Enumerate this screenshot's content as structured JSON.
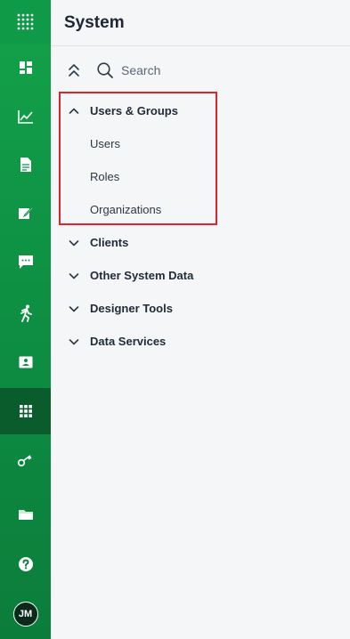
{
  "rail": {
    "items": [
      {
        "name": "apps-grid-icon"
      },
      {
        "name": "dashboard-icon"
      },
      {
        "name": "chart-icon"
      },
      {
        "name": "document-icon"
      },
      {
        "name": "edit-icon"
      },
      {
        "name": "chat-icon"
      },
      {
        "name": "run-icon"
      },
      {
        "name": "contact-card-icon"
      },
      {
        "name": "system-grid-icon",
        "active": true
      },
      {
        "name": "key-icon"
      },
      {
        "name": "folder-icon"
      },
      {
        "name": "help-icon"
      }
    ],
    "avatar_initials": "JM",
    "colors": {
      "rail": "#0e9244",
      "active": "#0a5c2c"
    }
  },
  "header": {
    "title": "System"
  },
  "search": {
    "placeholder": "Search",
    "value": ""
  },
  "tree": {
    "groups": [
      {
        "label": "Users & Groups",
        "expanded": true,
        "children": [
          "Users",
          "Roles",
          "Organizations"
        ]
      },
      {
        "label": "Clients",
        "expanded": false
      },
      {
        "label": "Other System Data",
        "expanded": false
      },
      {
        "label": "Designer Tools",
        "expanded": false
      },
      {
        "label": "Data Services",
        "expanded": false
      }
    ]
  },
  "highlight_color": "#e0242f"
}
